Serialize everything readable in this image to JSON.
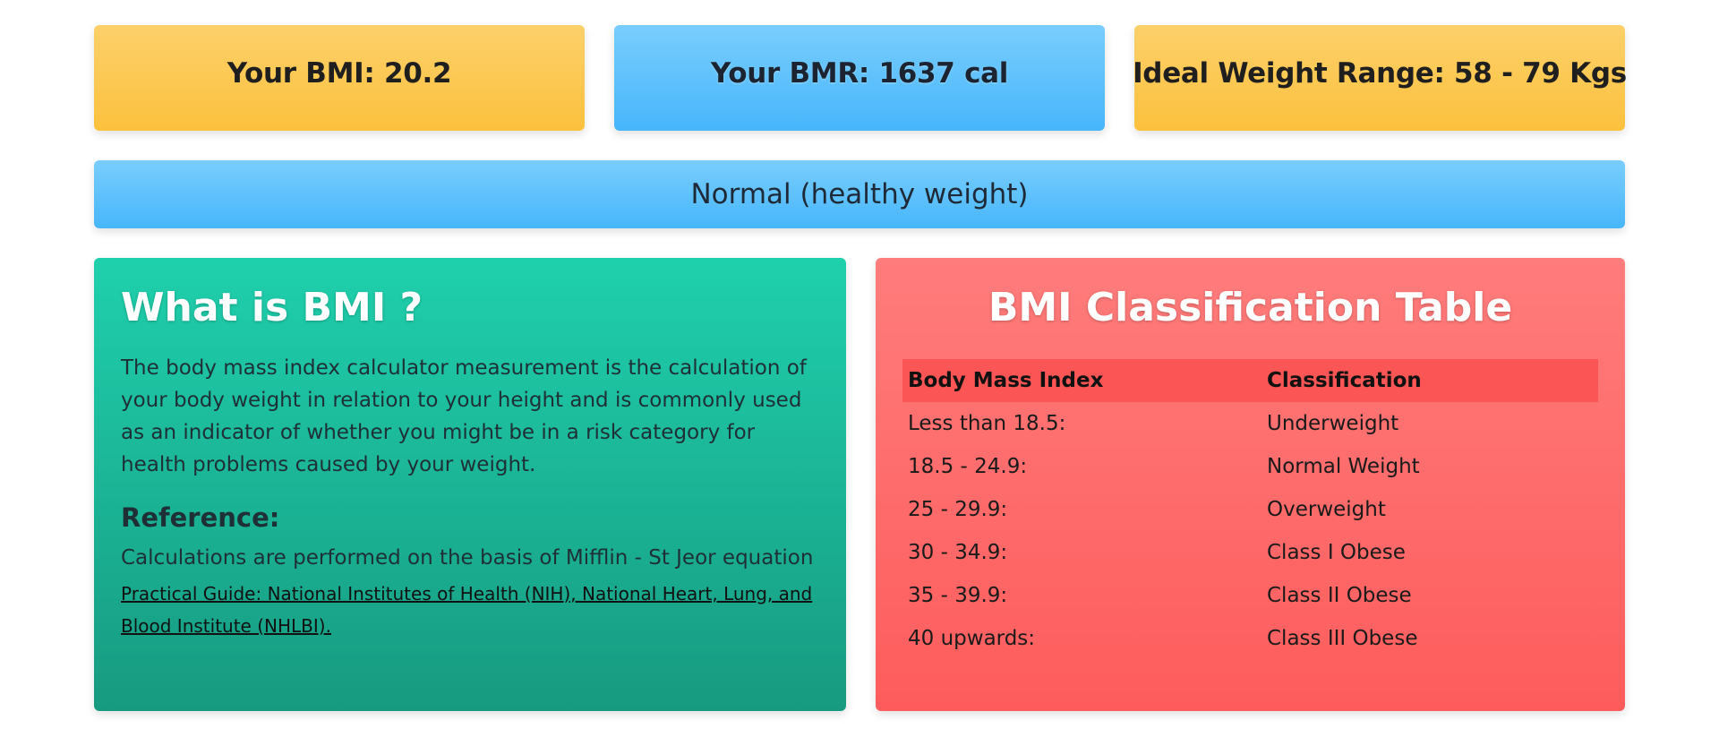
{
  "stats": {
    "bmi": "Your BMI: 20.2",
    "bmr": "Your BMR: 1637 cal",
    "ideal_weight": "Ideal Weight Range: 58 - 79 Kgs"
  },
  "status": "Normal (healthy weight)",
  "info": {
    "title": "What is BMI ?",
    "body": "The body mass index calculator measurement is the calculation of your body weight in relation to your height and is commonly used as an indicator of whether you might be in a risk category for health problems caused by your weight.",
    "reference_title": "Reference:",
    "reference_text": "Calculations are performed on the basis of Mifflin - St Jeor equation",
    "reference_link": "Practical Guide: National Institutes of Health (NIH), National Heart, Lung, and Blood Institute (NHLBI)."
  },
  "table": {
    "title": "BMI Classification Table",
    "headers": [
      "Body Mass Index",
      "Classification"
    ],
    "rows": [
      [
        "Less than 18.5:",
        "Underweight"
      ],
      [
        "18.5 - 24.9:",
        "Normal Weight"
      ],
      [
        "25 - 29.9:",
        "Overweight"
      ],
      [
        "30 - 34.9:",
        "Class I Obese"
      ],
      [
        "35 - 39.9:",
        "Class II Obese"
      ],
      [
        "40 upwards:",
        "Class III Obese"
      ]
    ]
  },
  "colors": {
    "yellow_card": "#fcc13d",
    "blue_card": "#47b6fb",
    "green_panel": "#1fd0ad",
    "red_panel": "#fe5c5c",
    "table_header": "#fb5555"
  }
}
